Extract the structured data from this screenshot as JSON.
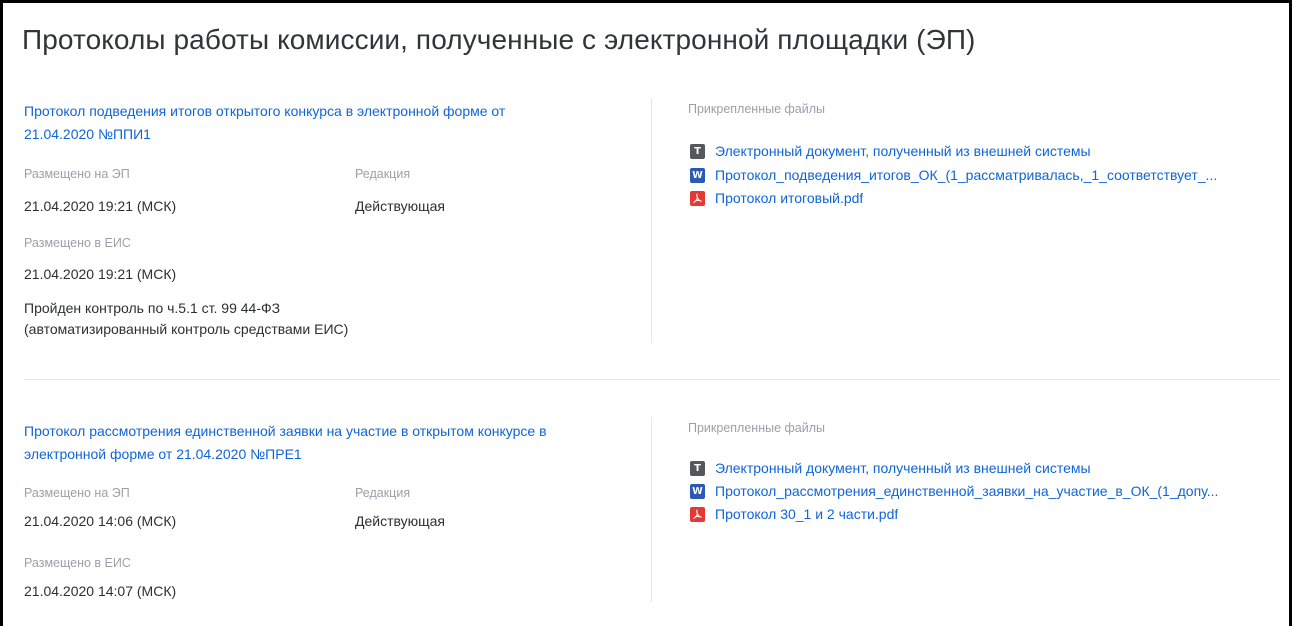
{
  "page": {
    "title": "Протоколы работы комиссии, полученные с электронной площадки (ЭП)"
  },
  "protocols": [
    {
      "link_line1": "Протокол подведения итогов открытого конкурса в электронной форме от",
      "link_line2": "21.04.2020 №ППИ1",
      "placed_ep_label": "Размещено на ЭП",
      "placed_ep_value": "21.04.2020 19:21 (МСК)",
      "edition_label": "Редакция",
      "edition_value": "Действующая",
      "placed_eis_label": "Размещено в ЕИС",
      "placed_eis_value": "21.04.2020 19:21 (МСК)",
      "control_line1": "Пройден контроль по ч.5.1 ст. 99 44-ФЗ",
      "control_line2": "(автоматизированный контроль средствами ЕИС)",
      "files_label": "Прикрепленные файлы",
      "files": [
        {
          "icon": "text-doc-icon",
          "name": "Электронный документ, полученный из внешней системы"
        },
        {
          "icon": "word-doc-icon",
          "name": "Протокол_подведения_итогов_ОК_(1_рассматривалась,_1_соответствует_..."
        },
        {
          "icon": "pdf-icon",
          "name": "Протокол итоговый.pdf"
        }
      ]
    },
    {
      "link_line1": "Протокол рассмотрения единственной заявки на участие в открытом конкурсе в",
      "link_line2": "электронной форме от 21.04.2020 №ПРЕ1",
      "placed_ep_label": "Размещено на ЭП",
      "placed_ep_value": "21.04.2020 14:06 (МСК)",
      "edition_label": "Редакция",
      "edition_value": "Действующая",
      "placed_eis_label": "Размещено в ЕИС",
      "placed_eis_value": "21.04.2020 14:07 (МСК)",
      "files_label": "Прикрепленные файлы",
      "files": [
        {
          "icon": "text-doc-icon",
          "name": "Электронный документ, полученный из внешней системы"
        },
        {
          "icon": "word-doc-icon",
          "name": "Протокол_рассмотрения_единственной_заявки_на_участие_в_ОК_(1_допу..."
        },
        {
          "icon": "pdf-icon",
          "name": "Протокол 30_1 и 2 части.pdf"
        }
      ]
    }
  ],
  "colors": {
    "link": "#0f65d7",
    "label": "#9ba0a9",
    "text": "#2d2f34",
    "pdf": "#e53935",
    "word": "#2b5ab5",
    "textdoc": "#54575c"
  }
}
